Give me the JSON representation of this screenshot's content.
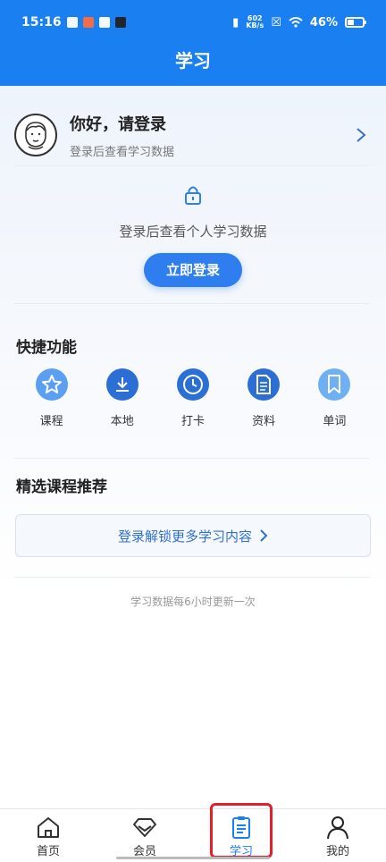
{
  "status_bar": {
    "time": "15:16",
    "net_speed_value": "602",
    "net_speed_unit": "KB/s",
    "battery_percent": "46%",
    "battery_level": 0.46
  },
  "header": {
    "title": "学习"
  },
  "user": {
    "greeting": "你好，请登录",
    "subtitle": "登录后查看学习数据"
  },
  "login_panel": {
    "prompt": "登录后查看个人学习数据",
    "button_label": "立即登录"
  },
  "quick_functions": {
    "title": "快捷功能",
    "items": [
      {
        "label": "课程",
        "icon": "star-icon"
      },
      {
        "label": "本地",
        "icon": "download-icon"
      },
      {
        "label": "打卡",
        "icon": "clock-icon"
      },
      {
        "label": "资料",
        "icon": "document-icon"
      },
      {
        "label": "单词",
        "icon": "bookmark-icon"
      }
    ]
  },
  "recommend": {
    "title": "精选课程推荐",
    "unlock_label": "登录解锁更多学习内容"
  },
  "update_note": "学习数据每6小时更新一次",
  "tabbar": {
    "tabs": [
      {
        "label": "首页",
        "icon": "home-icon"
      },
      {
        "label": "会员",
        "icon": "diamond-icon"
      },
      {
        "label": "学习",
        "icon": "clipboard-icon",
        "active": true
      },
      {
        "label": "我的",
        "icon": "person-icon"
      }
    ]
  },
  "colors": {
    "brand": "#1a7ff0",
    "accent_button": "#2f7ef0",
    "highlight": "#e0202a"
  }
}
